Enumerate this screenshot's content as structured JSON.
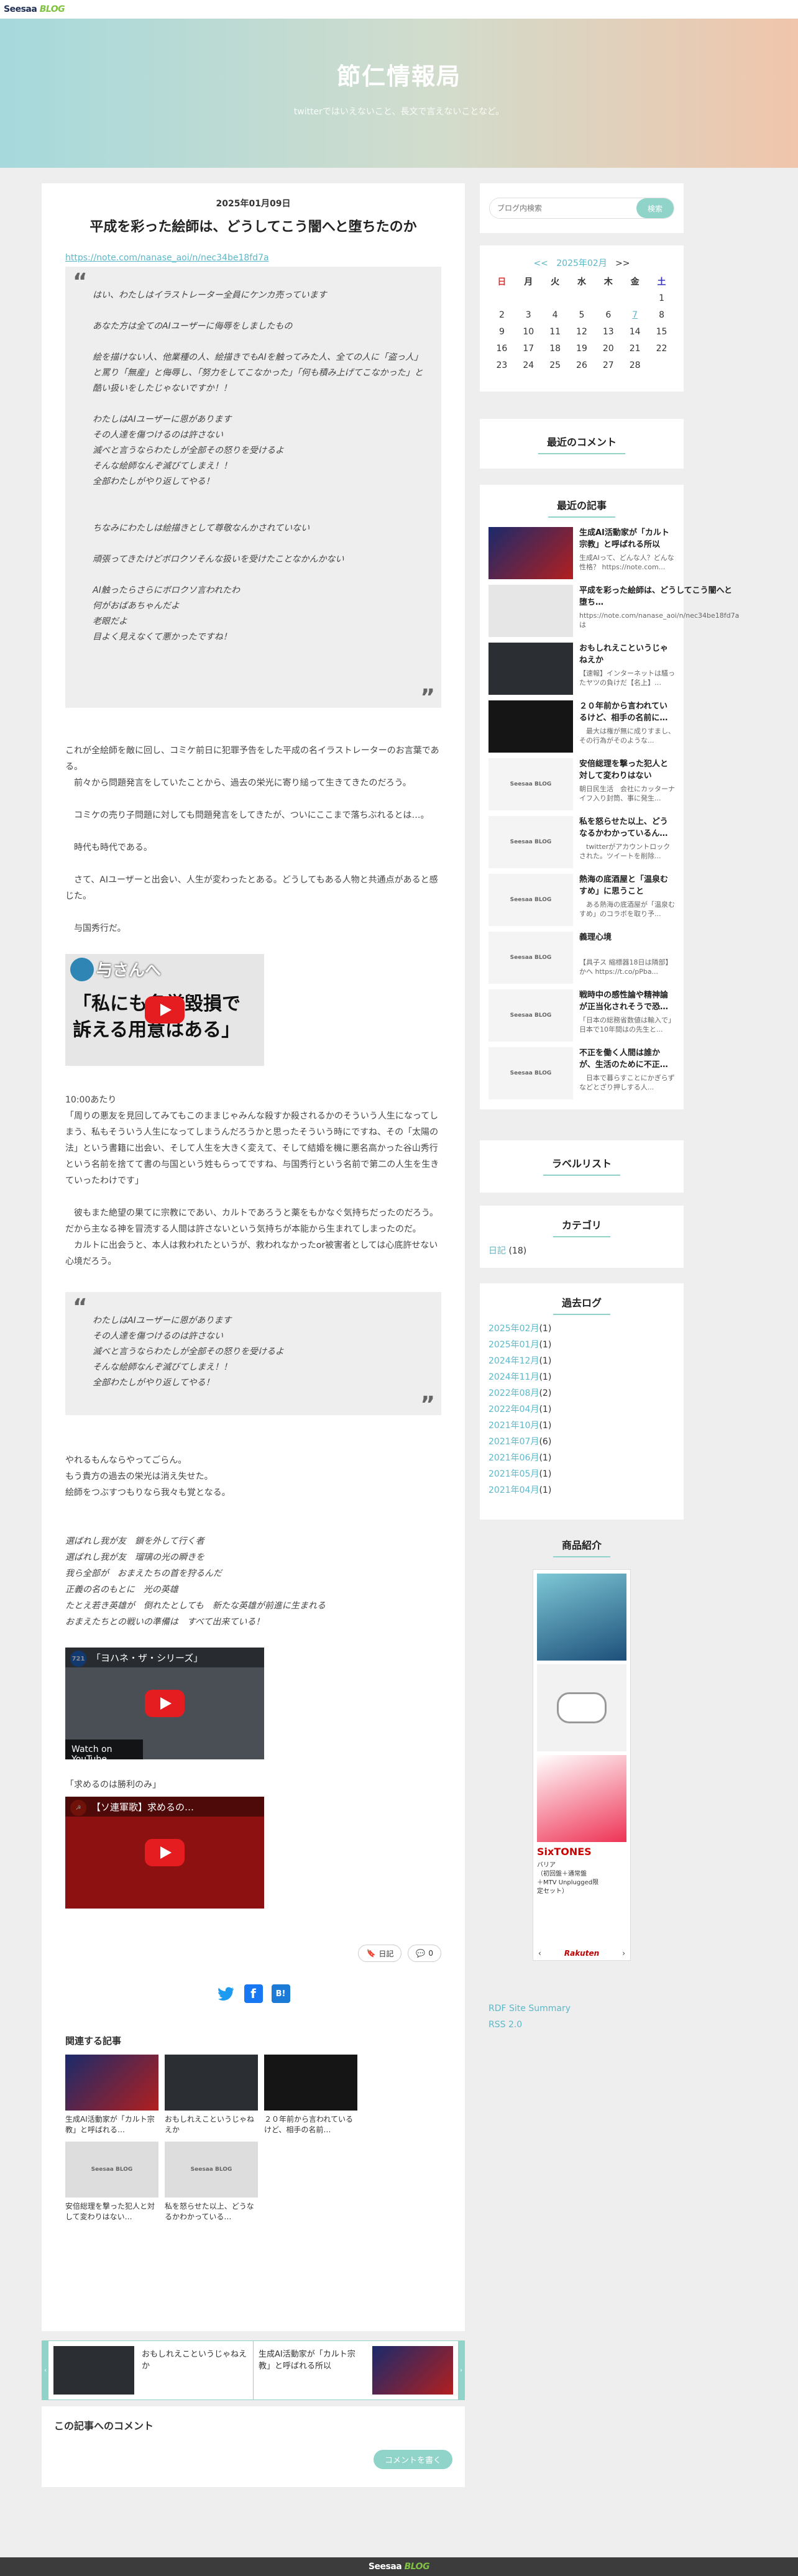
{
  "topbar": {
    "logo_part1": "Seesaa",
    "logo_part2": "BLOG"
  },
  "banner": {
    "title": "節仁情報局",
    "subtitle": "twitterではいえないこと、長文で言えないことなど。"
  },
  "article": {
    "date": "2025年01月09日",
    "title": "平成を彩った絵師は、どうしてこう闇へと堕ちたのか",
    "url": "https://note.com/nanase_aoi/n/nec34be18fd7a",
    "quote1": "はい、わたしはイラストレーター全員にケンカ売っています\n\nあなた方は全てのAIユーザーに侮辱をしましたもの\n\n絵を描けない人、他業種の人、絵描きでもAIを触ってみた人、全ての人に「盗っ人」と罵り「無産」と侮辱し、「努力をしてこなかった」「何も積み上げてこなかった」と酷い扱いをしたじゃないですか！！\n\nわたしはAIユーザーに恩があります\nその人達を傷つけるのは許さない\n滅べと言うならわたしが全部その怒りを受けるよ\nそんな絵師なんぞ滅びてしまえ！！\n全部わたしがやり返してやる！\n\n\nちなみにわたしは絵描きとして尊敬なんかされていない\n\n頑張ってきたけどボロクソそんな扱いを受けたことなかんかない\n\nAI触ったらさらにボロクソ言われたわ\n何がおばあちゃんだよ\n老眼だよ\n目よく見えなくて悪かったですね！",
    "para1": "これが全絵師を敵に回し、コミケ前日に犯罪予告をした平成の名イラストレーターのお言葉である。\n　前々から問題発言をしていたことから、過去の栄光に寄り縋って生きてきたのだろう。\n\n　コミケの売り子問題に対しても問題発言をしてきたが、ついにここまで落ちぶれるとは…。\n\n　時代も時代である。\n\n　さて、AIユーザーと出会い、人生が変わったとある。どうしてもある人物と共通点があると感じた。\n\n　与国秀行だ。",
    "video1_title": "「私にも名誉毀損で訴える用意はある」",
    "video1_caption_a": "与さんへ",
    "video1_caption_b": "「私にも名誉毀損で\n訴える用意はある」",
    "para2": "10:00あたり\n「周りの悪友を見回してみてもこのままじゃみんな殺すか殺されるかのそういう人生になってしまう、私もそういう人生になってしまうんだろうかと思ったそういう時にですね、その「太陽の法」という書籍に出会い、そして人生を大きく変えて、そして結婚を機に悪名高かった谷山秀行という名前を捨てて書の与国という姓もらってですね、与国秀行という名前で第二の人生を生きていったわけです」\n\n　彼もまた絶望の果てに宗教にであい、カルトであろうと薬をもかなぐ気持ちだったのだろう。だから主なる神を冒涜する人間は許さないという気持ちが本能から生まれてしまったのだ。\n　カルトに出会うと、本人は救われたというが、救われなかったor被害者としては心底許せない心境だろう。",
    "quote2": "わたしはAIユーザーに恩があります\nその人達を傷つけるのは許さない\n滅べと言うならわたしが全部その怒りを受けるよ\nそんな絵師なんぞ滅びてしまえ！！\n全部わたしがやり返してやる！",
    "para3": "やれるもんならやってごらん。\nもう貴方の過去の栄光は消え失せた。\n絵師をつぶすつもりなら我々も覚となる。",
    "poem": "選ばれし我が友　鎖を外して行く者\n選ばれし我が友　瑠璃の光の瞬きを\n我ら全部が　おまえたちの首を狩るんだ\n正義の名のもとに　光の英雄\nたとえ若き英雄が　倒れたとしても　新たな英雄が前進に生まれる\nおまえたちとの戦いの準備は　すべて出来ている！",
    "video2_title": "「ヨハネ・ザ・シリーズ」",
    "video2_badge": "721",
    "watch_on": "Watch on YouTube",
    "video3_label": "「求めるのは勝利のみ」",
    "video3_title": "【ソ連軍歌】求めるの…",
    "tag_btn": "日記",
    "comment_btn": "0",
    "related_title": "関連する記事",
    "related": [
      {
        "title": "生成AI活動家が「カルト宗教」と呼ばれる…"
      },
      {
        "title": "おもしれえこというじゃねえか"
      },
      {
        "title": "２０年前から言われているけど、相手の名前…"
      },
      {
        "title": "安倍総理を撃った犯人と対して変わりはない…"
      },
      {
        "title": "私を怒らせた以上、どうなるかわかっている…"
      }
    ]
  },
  "pager": {
    "prev": "おもしれえこというじゃねえか",
    "next": "生成AI活動家が「カルト宗教」と呼ばれる所以"
  },
  "comments": {
    "title": "この記事へのコメント",
    "button": "コメントを書く"
  },
  "sidebar": {
    "search_placeholder": "ブログ内検索",
    "search_button": "検索",
    "calendar": {
      "prev": "<<",
      "month": "2025年02月",
      "next": ">>",
      "weekdays": [
        "日",
        "月",
        "火",
        "水",
        "木",
        "金",
        "土"
      ],
      "rows": [
        [
          "",
          "",
          "",
          "",
          "",
          "",
          "1"
        ],
        [
          "2",
          "3",
          "4",
          "5",
          "6",
          "7",
          "8"
        ],
        [
          "9",
          "10",
          "11",
          "12",
          "13",
          "14",
          "15"
        ],
        [
          "16",
          "17",
          "18",
          "19",
          "20",
          "21",
          "22"
        ],
        [
          "23",
          "24",
          "25",
          "26",
          "27",
          "28",
          ""
        ]
      ]
    },
    "recent_comments_title": "最近のコメント",
    "recent_posts_title": "最近の記事",
    "recent_posts": [
      {
        "title": "生成AI活動家が「カルト宗教」と呼ばれる所以",
        "excerpt": "生成AIって、どんな人？どんな性格？ https://note.com..."
      },
      {
        "title": "平成を彩った絵師は、どうしてこう闇へと堕ち…",
        "excerpt": "https://note.com/nanase_aoi/n/nec34be18fd7a は"
      },
      {
        "title": "おもしれえこというじゃねえか",
        "excerpt": "【速報】インターネットは騒ったヤツの負けだ【名上】…"
      },
      {
        "title": "２０年前から言われているけど、相手の名前に…",
        "excerpt": "　最大は権が無に成りすまし、その行為がそのような..."
      },
      {
        "title": "安倍総理を撃った犯人と対して変わりはない",
        "excerpt": "朝日民生活　会社にカッターナイフ入り封筒、事に発生..."
      },
      {
        "title": "私を怒らせた以上、どうなるかわかっているん…",
        "excerpt": "　twitterがアカウントロックされた。ツイートを削除..."
      },
      {
        "title": "熱海の底酒屋と「温泉むすめ」に思うこと",
        "excerpt": "　ある熱海の底酒屋が「温泉むすめ」のコラボを取り予..."
      },
      {
        "title": "義理心境",
        "excerpt": "【具子ス 縮標器18日は隣部】かへ https://t.co/pPba..."
      },
      {
        "title": "戦時中の感性論や精神論が正当化されそうで恐…",
        "excerpt": "「日本の総務省数値は輸入で」日本で10年間はの先生と..."
      },
      {
        "title": "不正を働く人間は誰かが、生活のために不正…",
        "excerpt": "　日本で暮らすことにかぎらずなどとざり押しする人..."
      }
    ],
    "label_list_title": "ラベルリスト",
    "category_title": "カテゴリ",
    "category": {
      "name": "日記",
      "count": "(18)"
    },
    "archive_title": "過去ログ",
    "archive": [
      {
        "month": "2025年02月",
        "count": "(1)"
      },
      {
        "month": "2025年01月",
        "count": "(1)"
      },
      {
        "month": "2024年12月",
        "count": "(1)"
      },
      {
        "month": "2024年11月",
        "count": "(1)"
      },
      {
        "month": "2022年08月",
        "count": "(2)"
      },
      {
        "month": "2022年04月",
        "count": "(1)"
      },
      {
        "month": "2021年10月",
        "count": "(1)"
      },
      {
        "month": "2021年07月",
        "count": "(6)"
      },
      {
        "month": "2021年06月",
        "count": "(1)"
      },
      {
        "month": "2021年05月",
        "count": "(1)"
      },
      {
        "month": "2021年04月",
        "count": "(1)"
      }
    ],
    "products_title": "商品紹介",
    "product_name": "SixTONES",
    "product_desc": "バリア\n（初回盤＋通常盤\n＋MTV Unplugged限\n定セット）",
    "rakuten": "Rakuten",
    "feeds": [
      "RDF Site Summary",
      "RSS 2.0"
    ]
  },
  "placeholder_logo": "Seesaa BLOG",
  "colors": {
    "accent": "#8fd3c9",
    "link": "#5cb8c9",
    "banner_left": "#a6d9dc",
    "banner_right": "#f0c5ab"
  }
}
